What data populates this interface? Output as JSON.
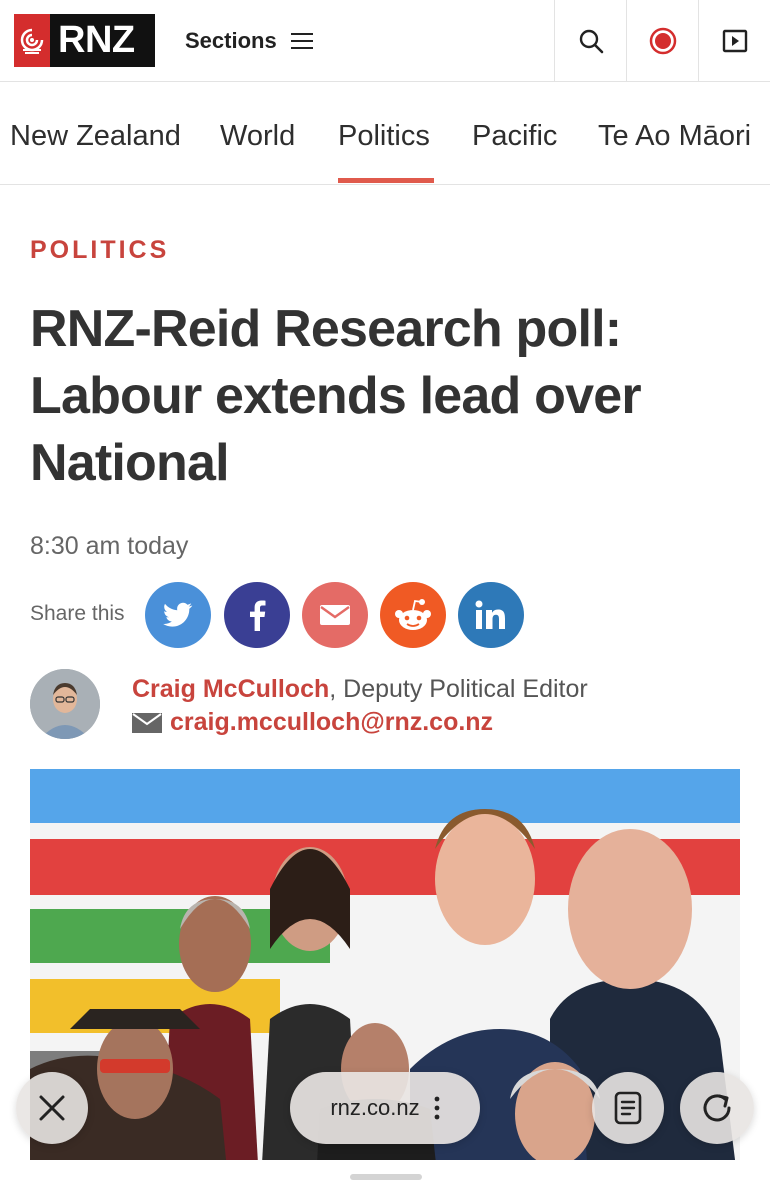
{
  "header": {
    "logo_text": "RNZ",
    "sections_label": "Sections",
    "brand_color": "#d42d2d"
  },
  "nav": {
    "items": [
      "New Zealand",
      "World",
      "Politics",
      "Pacific",
      "Te Ao Māori"
    ],
    "active": "Politics",
    "active_color": "#e05a4c"
  },
  "article": {
    "kicker": "POLITICS",
    "headline": "RNZ-Reid Research poll: Labour extends lead over National",
    "timestamp": "8:30 am today",
    "share_label": "Share this",
    "share_buttons": [
      {
        "name": "twitter",
        "icon": "twitter-bird-icon",
        "color": "#4a90d9"
      },
      {
        "name": "facebook",
        "icon": "facebook-f-icon",
        "color": "#3a3f94"
      },
      {
        "name": "email",
        "icon": "envelope-icon",
        "color": "#e46b66"
      },
      {
        "name": "reddit",
        "icon": "reddit-alien-icon",
        "color": "#f05a24"
      },
      {
        "name": "linkedin",
        "icon": "linkedin-in-icon",
        "color": "#2e79b8"
      }
    ],
    "author_name": "Craig McCulloch",
    "author_title": ", Deputy Political Editor",
    "author_email": "craig.mcculloch@rnz.co.nz"
  },
  "browser": {
    "url": "rnz.co.nz"
  }
}
